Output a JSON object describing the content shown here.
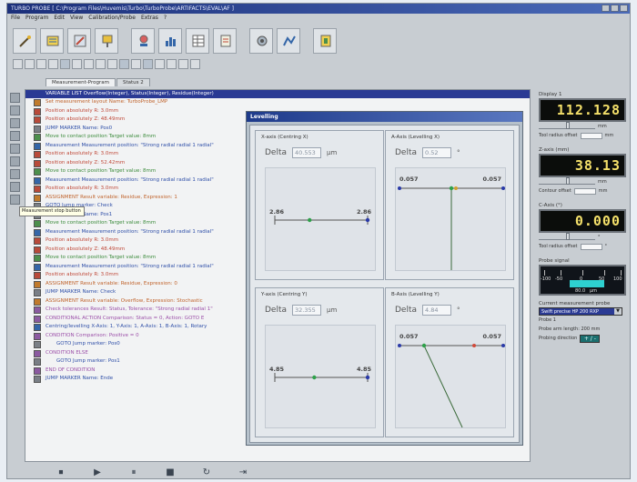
{
  "window": {
    "title": "TURBO PROBE [ C:\\Program Files\\Huvemis\\Turbo\\TurboProbe\\ARTIFACTS\\EVAL\\AF ]"
  },
  "menu": [
    "File",
    "Program",
    "Edit",
    "View",
    "Calibration/Probe",
    "Extras",
    "?"
  ],
  "tabs": [
    "Measurement-Program",
    "Status 2"
  ],
  "program": {
    "header": "VARIABLE LIST Overflow(Integer), Status(Integer), Residue(Integer)",
    "lines": [
      {
        "type": "set",
        "text": "Set measurement layout Name: TurboProbe_LMP"
      },
      {
        "type": "pos",
        "text": "Position absolutely R: 3.0mm"
      },
      {
        "type": "pos",
        "text": "Position absolutely Z: 48.49mm"
      },
      {
        "type": "jump",
        "text": "JUMP MARKER Name: Pos0"
      },
      {
        "type": "move",
        "text": "Move to contact position Target value: 8mm"
      },
      {
        "type": "meas",
        "text": "Measurement Measurement position: \"Strong radial radial 1 radial\""
      },
      {
        "type": "pos",
        "text": "Position absolutely R: 3.0mm"
      },
      {
        "type": "pos",
        "text": "Position absolutely Z: 52.42mm"
      },
      {
        "type": "move",
        "text": "Move to contact position Target value: 8mm"
      },
      {
        "type": "meas",
        "text": "Measurement Measurement position: \"Strong radial radial 1 radial\""
      },
      {
        "type": "pos",
        "text": "Position absolutely R: 3.0mm"
      },
      {
        "type": "set",
        "text": "ASSIGNMENT Result variable: Residue, Expression: 1"
      },
      {
        "type": "jump",
        "text": "GOTO Jump marker: Check"
      },
      {
        "type": "jump",
        "text": "JUMP MARKER Name: Pos1"
      },
      {
        "type": "move",
        "text": "Move to contact position Target value: 8mm"
      },
      {
        "type": "meas",
        "text": "Measurement Measurement position: \"Strong radial radial 1 radial\""
      },
      {
        "type": "pos",
        "text": "Position absolutely R: 3.0mm"
      },
      {
        "type": "pos",
        "text": "Position absolutely Z: 48.49mm"
      },
      {
        "type": "move",
        "text": "Move to contact position Target value: 8mm"
      },
      {
        "type": "meas",
        "text": "Measurement Measurement position: \"Strong radial radial 1 radial\""
      },
      {
        "type": "pos",
        "text": "Position absolutely R: 3.0mm"
      },
      {
        "type": "set",
        "text": "ASSIGNMENT Result variable: Residue, Expression: 0"
      },
      {
        "type": "jump",
        "text": "JUMP MARKER Name: Check"
      },
      {
        "type": "set",
        "text": "ASSIGNMENT Result variable: Overflow, Expression: Stochastic"
      },
      {
        "type": "cond",
        "text": "Check tolerances Result: Status, Tolerance: \"Strong radial radial 1\""
      },
      {
        "type": "cond",
        "text": "CONDITIONAL ACTION Comparison: Status = 0, Action: GOTO E"
      },
      {
        "type": "meas",
        "text": "Centring/levelling X-Axis: 1, Y-Axis: 1, A-Axis: 1, B-Axis: 1, Rotary"
      },
      {
        "type": "cond",
        "text": "CONDITION Comparison: Positive = 0"
      },
      {
        "type": "jump",
        "text": "GOTO Jump marker: Pos0",
        "indent": true
      },
      {
        "type": "cond",
        "text": "CONDITION ELSE"
      },
      {
        "type": "jump",
        "text": "GOTO Jump marker: Pos1",
        "indent": true
      },
      {
        "type": "cond",
        "text": "END OF CONDITION"
      },
      {
        "type": "jump",
        "text": "JUMP MARKER Name: Ende"
      }
    ]
  },
  "levelling": {
    "title": "Levelling",
    "panels": [
      {
        "title": "X-axis (Centring X)",
        "delta_label": "Delta",
        "delta_value": "40.553",
        "unit": "µm",
        "left_value": "2.86",
        "right_value": "2.86",
        "mode": "centre",
        "marker": 0.25
      },
      {
        "title": "A-Axis (Levelling X)",
        "delta_label": "Delta",
        "delta_value": "0.52",
        "unit": "°",
        "left_value": "0.057",
        "right_value": "0.057",
        "mode": "tilt",
        "marker": 0.0
      },
      {
        "title": "Y-axis (Centring Y)",
        "delta_label": "Delta",
        "delta_value": "32.355",
        "unit": "µm",
        "left_value": "4.85",
        "right_value": "4.85",
        "mode": "centre",
        "marker": 0.15
      },
      {
        "title": "B-Axis (Levelling Y)",
        "delta_label": "Delta",
        "delta_value": "4.84",
        "unit": "°",
        "left_value": "0.057",
        "right_value": "0.057",
        "mode": "tilt",
        "marker": 0.3
      }
    ]
  },
  "right_panel": {
    "blocks": [
      {
        "title": "Display 1",
        "lcd": "112.128",
        "row1_unit": "mm",
        "row2_label": "Tool radius offset",
        "row2_unit": "mm"
      },
      {
        "title": "Z-axis (mm)",
        "lcd": "38.13",
        "row1_unit": "mm",
        "row2_label": "Contour offset",
        "row2_unit": "mm"
      },
      {
        "title": "C-Axis (°)",
        "lcd": "0.000",
        "row1_unit": "°",
        "row2_label": "Tool radius offset",
        "row2_unit": "°"
      }
    ],
    "probe_title": "Probe signal",
    "gauge_labels": [
      "-100",
      "-50",
      "0",
      "50",
      "100"
    ],
    "gauge_value": "80.0",
    "gauge_unit": "µm",
    "select_label": "Current measurement probe",
    "select_value": "Swift precise HP 200 RXP",
    "probe_lines": [
      "Probe 1",
      "Probe arm length: 200 mm"
    ],
    "probe_button_label": "Probing direction",
    "probe_button": "+ / -"
  },
  "playbar": [
    "⏹",
    "▶",
    "⏸",
    "■",
    "↻",
    "⇥"
  ],
  "tooltip": "Measurement stop button"
}
